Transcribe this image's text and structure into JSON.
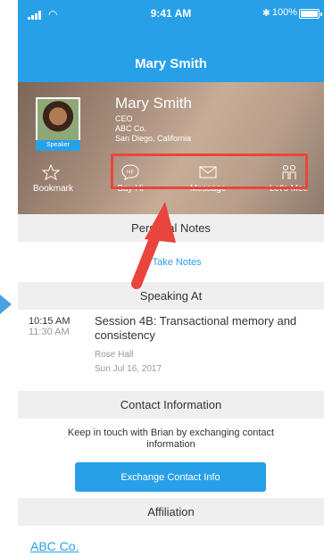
{
  "status_bar": {
    "time": "9:41 AM",
    "bluetooth": "✱",
    "battery": "100%",
    "battery_level": 1.0
  },
  "nav": {
    "title": "Mary Smith"
  },
  "profile": {
    "name": "Mary Smith",
    "title": "CEO",
    "company": "ABC Co.",
    "location": "San Diego, California",
    "badge": "Speaker"
  },
  "actions": [
    {
      "label": "Bookmark",
      "icon": "star-icon"
    },
    {
      "label": "Say Hi",
      "icon": "hi-bubble-icon"
    },
    {
      "label": "Message",
      "icon": "envelope-icon"
    },
    {
      "label": "Let's Mee",
      "icon": "people-meet-icon"
    }
  ],
  "sections": {
    "personal_notes": {
      "header": "Personal Notes",
      "take_notes": "Take Notes"
    },
    "speaking_at": {
      "header": "Speaking At",
      "session": {
        "start": "10:15 AM",
        "end": "11:30 AM",
        "title": "Session 4B: Transactional memory and consistency",
        "room": "Rose Hall",
        "date": "Sun Jul 16, 2017"
      }
    },
    "contact": {
      "header": "Contact Information",
      "text": "Keep in touch with Brian by exchanging contact information",
      "button": "Exchange Contact Info"
    },
    "affiliation": {
      "header": "Affiliation",
      "link": "ABC Co."
    }
  },
  "colors": {
    "accent": "#27a0e8",
    "annotation": "#e9453c",
    "section_bg": "#efefef"
  }
}
